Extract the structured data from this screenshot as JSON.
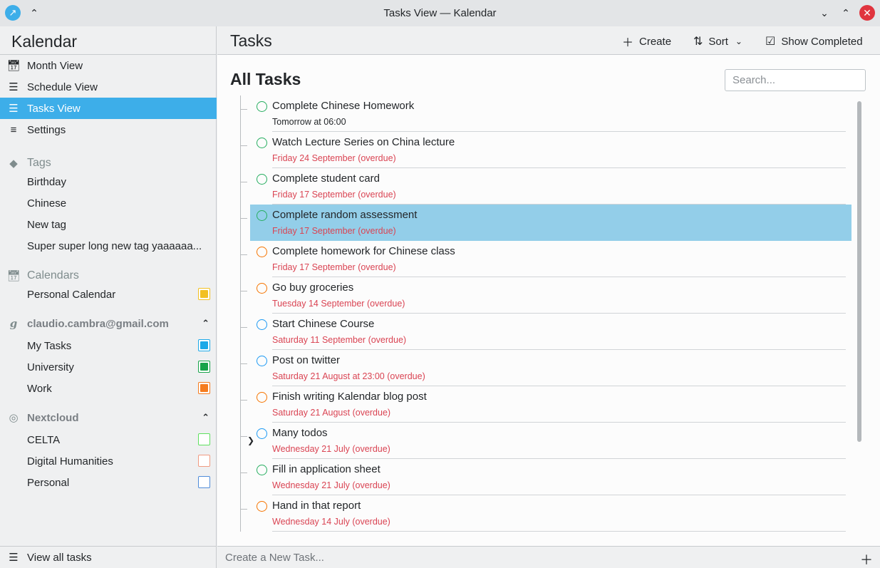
{
  "window": {
    "title": "Tasks View — Kalendar",
    "icons": {
      "app": "kalendar-app-icon",
      "keep_above": "chevron-double-up-icon",
      "minimize": "chevron-down-icon",
      "maximize": "chevron-up-icon",
      "close": "close-icon"
    }
  },
  "sidebar": {
    "title": "Kalendar",
    "nav": [
      {
        "label": "Month View",
        "icon": "calendar-month-icon"
      },
      {
        "label": "Schedule View",
        "icon": "schedule-list-icon"
      },
      {
        "label": "Tasks View",
        "icon": "tasks-list-icon",
        "active": true
      },
      {
        "label": "Settings",
        "icon": "settings-sliders-icon"
      }
    ],
    "tags": {
      "heading": "Tags",
      "items": [
        "Birthday",
        "Chinese",
        "New tag",
        "Super super long new tag yaaaaaa..."
      ]
    },
    "calendars": {
      "heading": "Calendars",
      "items": [
        {
          "label": "Personal Calendar",
          "color": "#f2c020"
        }
      ]
    },
    "google": {
      "heading": "claudio.cambra@gmail.com",
      "items": [
        {
          "label": "My Tasks",
          "color": "#1da9e8"
        },
        {
          "label": "University",
          "color": "#18a34a"
        },
        {
          "label": "Work",
          "color": "#f57c1f"
        }
      ]
    },
    "nextcloud": {
      "heading": "Nextcloud",
      "items": [
        {
          "label": "CELTA",
          "color": "#5ee05e"
        },
        {
          "label": "Digital Humanities",
          "color": "#f09a80"
        },
        {
          "label": "Personal",
          "color": "#4f8cd9"
        }
      ]
    },
    "footer": {
      "label": "View all tasks"
    }
  },
  "main": {
    "title": "Tasks",
    "toolbar": {
      "create": "Create",
      "sort": "Sort",
      "show_completed": "Show Completed"
    },
    "list_title": "All Tasks",
    "search_placeholder": "Search...",
    "tasks": [
      {
        "name": "Complete Chinese Homework",
        "due": "Tomorrow at 06:00",
        "color": "#27ae60",
        "overdue": false
      },
      {
        "name": "Watch Lecture Series on China lecture",
        "due": "Friday 24 September (overdue)",
        "color": "#27ae60",
        "overdue": true
      },
      {
        "name": "Complete student card",
        "due": "Friday 17 September (overdue)",
        "color": "#27ae60",
        "overdue": true
      },
      {
        "name": "Complete random assessment",
        "due": "Friday 17 September (overdue)",
        "color": "#27ae60",
        "overdue": true,
        "selected": true
      },
      {
        "name": "Complete homework for Chinese class",
        "due": "Friday 17 September (overdue)",
        "color": "#f67400",
        "overdue": true
      },
      {
        "name": "Go buy groceries",
        "due": "Tuesday 14 September (overdue)",
        "color": "#f67400",
        "overdue": true
      },
      {
        "name": "Start Chinese Course",
        "due": "Saturday 11 September (overdue)",
        "color": "#1d99f3",
        "overdue": true
      },
      {
        "name": "Post on twitter",
        "due": "Saturday 21 August at 23:00 (overdue)",
        "color": "#1d99f3",
        "overdue": true
      },
      {
        "name": "Finish writing Kalendar blog post",
        "due": "Saturday 21 August (overdue)",
        "color": "#f67400",
        "overdue": true
      },
      {
        "name": "Many todos",
        "due": "Wednesday 21 July (overdue)",
        "color": "#1d99f3",
        "overdue": true,
        "expandable": true
      },
      {
        "name": "Fill in application sheet",
        "due": "Wednesday 21 July (overdue)",
        "color": "#27ae60",
        "overdue": true
      },
      {
        "name": "Hand in that report",
        "due": "Wednesday 14 July (overdue)",
        "color": "#f67400",
        "overdue": true
      }
    ],
    "new_task_placeholder": "Create a New Task..."
  }
}
